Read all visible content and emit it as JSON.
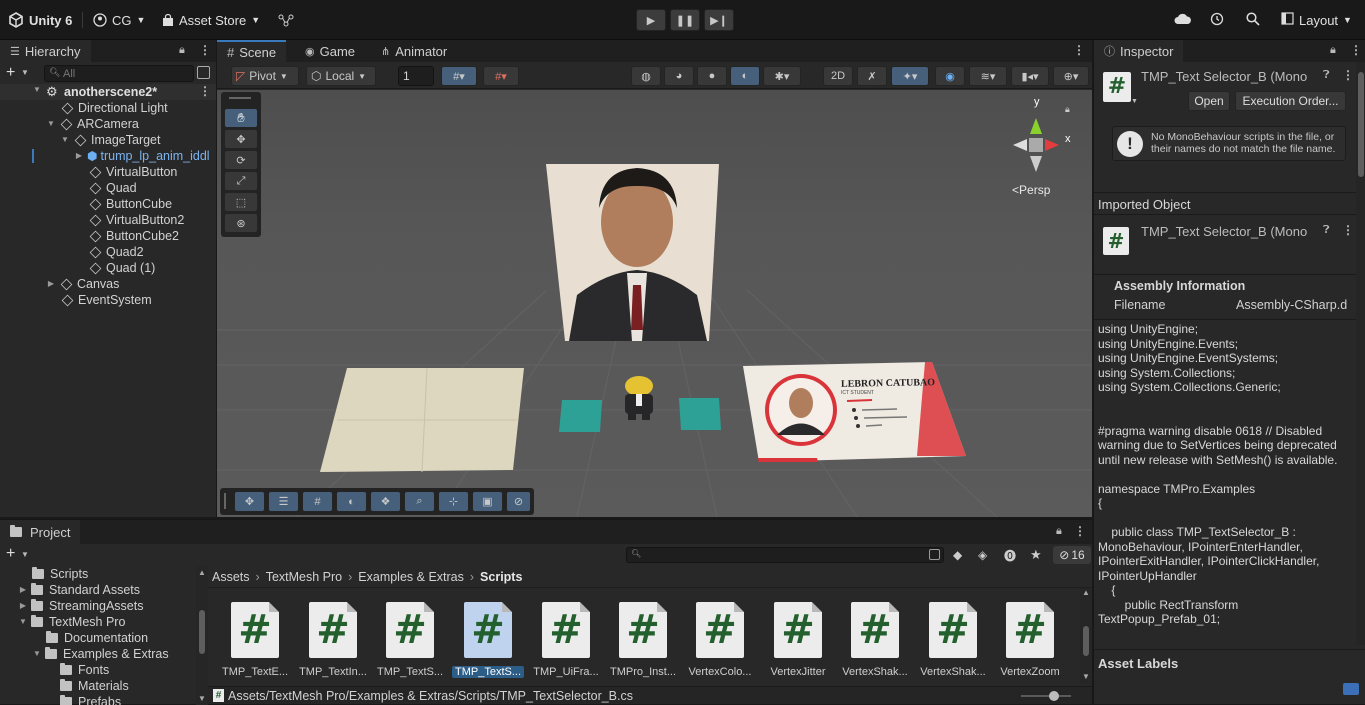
{
  "topbar": {
    "app_name": "Unity 6",
    "account": "CG",
    "asset_store": "Asset Store",
    "layout": "Layout"
  },
  "hierarchy": {
    "tab": "Hierarchy",
    "search_placeholder": "All",
    "scene": "anotherscene2*",
    "items": [
      {
        "label": "Directional Light"
      },
      {
        "label": "ARCamera"
      },
      {
        "label": "ImageTarget"
      },
      {
        "label": "trump_lp_anim_iddl"
      },
      {
        "label": "VirtualButton"
      },
      {
        "label": "Quad"
      },
      {
        "label": "ButtonCube"
      },
      {
        "label": "VirtualButton2"
      },
      {
        "label": "ButtonCube2"
      },
      {
        "label": "Quad2"
      },
      {
        "label": "Quad (1)"
      },
      {
        "label": "Canvas"
      },
      {
        "label": "EventSystem"
      }
    ]
  },
  "center_tabs": [
    "Scene",
    "Game",
    "Animator"
  ],
  "scene_toolbar": {
    "pivot": "Pivot",
    "local": "Local",
    "grid_value": "1",
    "persp": "Persp",
    "gizmo_y": "y",
    "gizmo_x": "x"
  },
  "scene_content": {
    "card_name": "LEBRON CATUBAO",
    "card_title": "ICT STUDENT"
  },
  "inspector": {
    "tab": "Inspector",
    "title": "TMP_Text Selector_B (Mono",
    "open": "Open",
    "exec_order": "Execution Order...",
    "warning": "No MonoBehaviour scripts in the file, or their names do not match the file name.",
    "imported_object": "Imported Object",
    "title2": "TMP_Text Selector_B (Mono",
    "assembly_info": "Assembly Information",
    "filename_label": "Filename",
    "filename_value": "Assembly-CSharp.d",
    "code": "using UnityEngine;\nusing UnityEngine.Events;\nusing UnityEngine.EventSystems;\nusing System.Collections;\nusing System.Collections.Generic;\n\n\n#pragma warning disable 0618 // Disabled warning due to SetVertices being deprecated until new release with SetMesh() is available.\n\nnamespace TMPro.Examples\n{\n\n    public class TMP_TextSelector_B : MonoBehaviour, IPointerEnterHandler, IPointerExitHandler, IPointerClickHandler, IPointerUpHandler\n    {\n        public RectTransform TextPopup_Prefab_01;",
    "asset_labels": "Asset Labels"
  },
  "project": {
    "tab": "Project",
    "hidden_count": "16",
    "tree": [
      {
        "label": "Scripts"
      },
      {
        "label": "Standard Assets"
      },
      {
        "label": "StreamingAssets"
      },
      {
        "label": "TextMesh Pro"
      },
      {
        "label": "Documentation"
      },
      {
        "label": "Examples & Extras"
      },
      {
        "label": "Fonts"
      },
      {
        "label": "Materials"
      },
      {
        "label": "Prefabs"
      }
    ],
    "breadcrumb": [
      "Assets",
      "TextMesh Pro",
      "Examples & Extras",
      "Scripts"
    ],
    "assets": [
      {
        "label": "TMP_TextE..."
      },
      {
        "label": "TMP_TextIn..."
      },
      {
        "label": "TMP_TextS..."
      },
      {
        "label": "TMP_TextS..."
      },
      {
        "label": "TMP_UiFra..."
      },
      {
        "label": "TMPro_Inst..."
      },
      {
        "label": "VertexColo..."
      },
      {
        "label": "VertexJitter"
      },
      {
        "label": "VertexShak..."
      },
      {
        "label": "VertexShak..."
      },
      {
        "label": "VertexZoom"
      }
    ],
    "status_path": "Assets/TextMesh Pro/Examples & Extras/Scripts/TMP_TextSelector_B.cs"
  }
}
